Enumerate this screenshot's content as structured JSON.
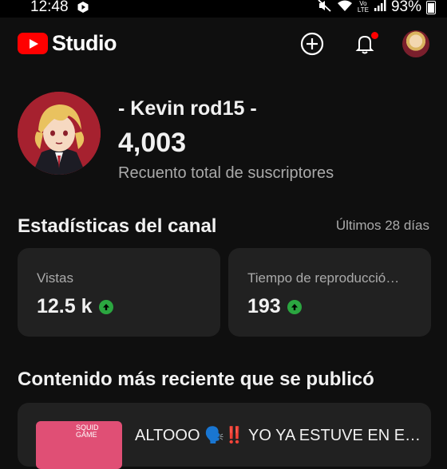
{
  "status_bar": {
    "time": "12:48",
    "network_label": "Vo\nLTE",
    "battery": "93%"
  },
  "app_bar": {
    "logo_text": "Studio",
    "icons": [
      "create-icon",
      "notifications-icon",
      "account-avatar"
    ],
    "notification_dot_color": "#ff0000"
  },
  "channel": {
    "name": "- Kevin rod15 -",
    "subscribers": "4,003",
    "subscribers_label": "Recuento total de suscriptores"
  },
  "stats": {
    "title": "Estadísticas del canal",
    "period": "Últimos 28 días",
    "cards": [
      {
        "label": "Vistas",
        "value": "12.5 k",
        "trend": "up"
      },
      {
        "label": "Tiempo de reproducció…",
        "value": "193",
        "trend": "up"
      }
    ],
    "trend_color": "#2ba640"
  },
  "recent": {
    "title": "Contenido más reciente que se publicó",
    "video_title": "ALTOOO 🗣️‼️ YO YA ESTUVE EN E…",
    "thumbnail_text": "SQUID\nGAME"
  },
  "colors": {
    "background": "#0f0f0f",
    "card": "#212121",
    "brand_red": "#ff0000",
    "secondary_text": "#aaaaaa"
  }
}
